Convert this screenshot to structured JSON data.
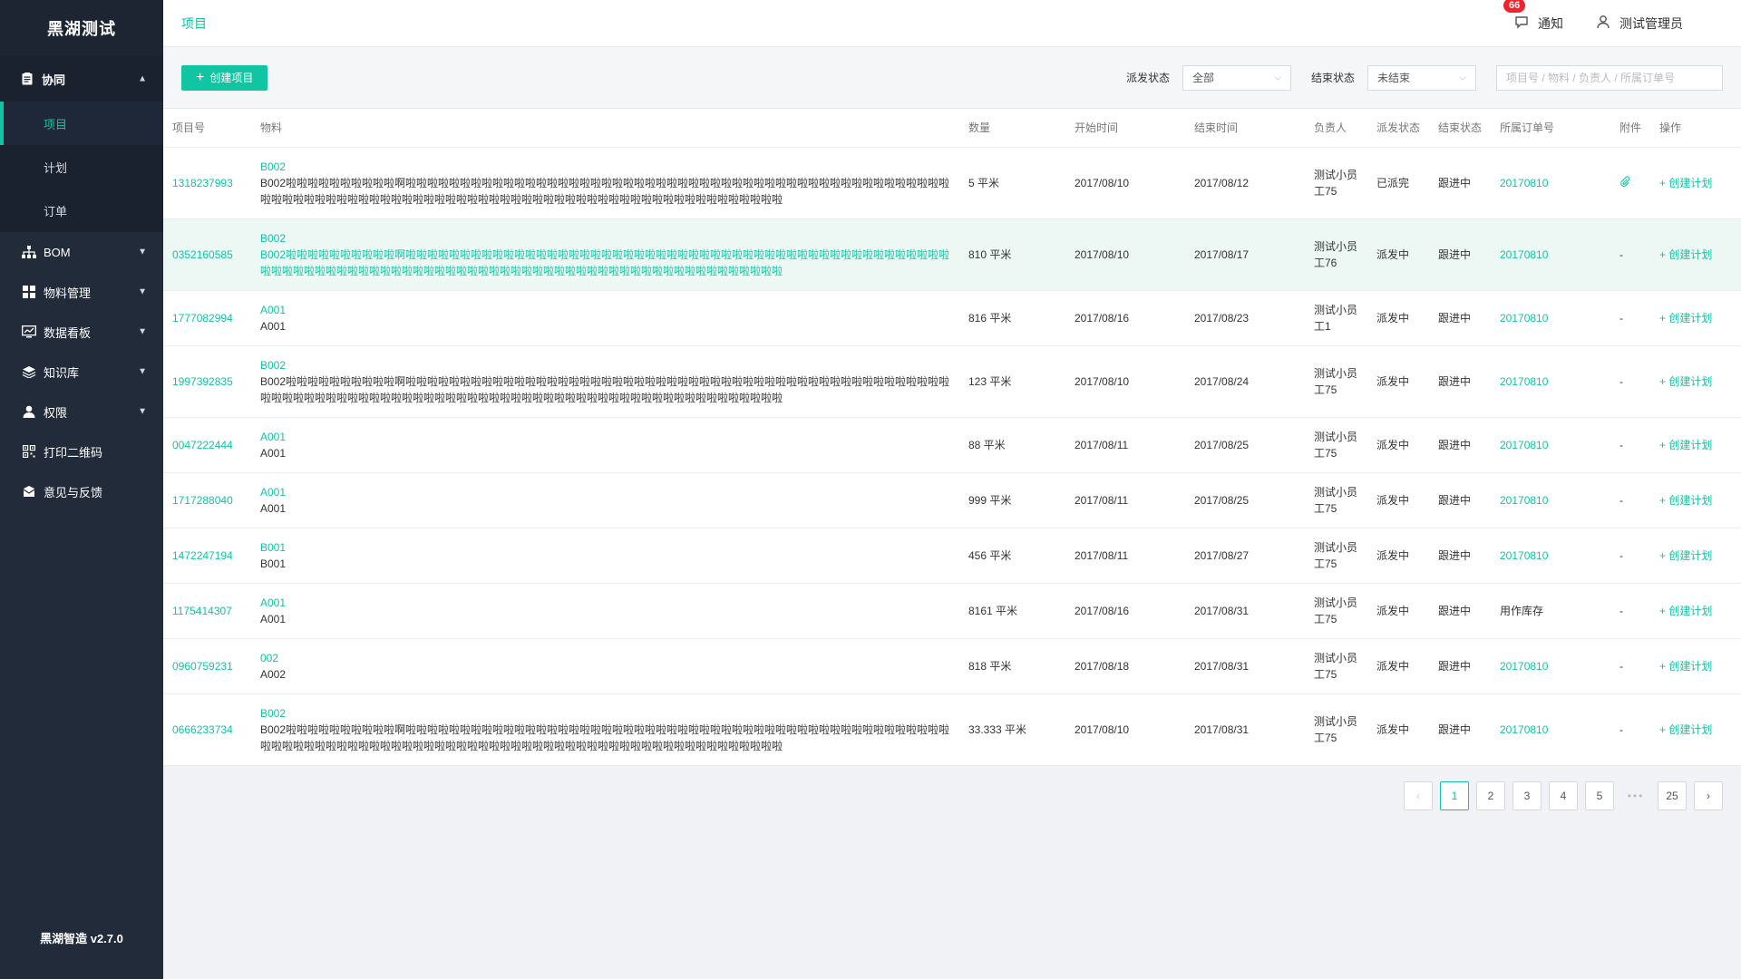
{
  "brand": "黑湖测试",
  "version": "黑湖智造 v2.7.0",
  "sidebar": {
    "group": {
      "label": "协同",
      "icon": "clipboard-icon",
      "items": [
        "项目",
        "计划",
        "订单"
      ],
      "active": 0
    },
    "items": [
      {
        "label": "BOM",
        "icon": "sitemap-icon",
        "chevron": true
      },
      {
        "label": "物料管理",
        "icon": "grid-icon",
        "chevron": true
      },
      {
        "label": "数据看板",
        "icon": "chart-icon",
        "chevron": true
      },
      {
        "label": "知识库",
        "icon": "layers-icon",
        "chevron": true
      },
      {
        "label": "权限",
        "icon": "user-icon",
        "chevron": true
      },
      {
        "label": "打印二维码",
        "icon": "qrcode-icon",
        "chevron": false
      },
      {
        "label": "意见与反馈",
        "icon": "mail-icon",
        "chevron": false
      }
    ]
  },
  "header": {
    "title": "项目",
    "notify_label": "通知",
    "notify_count": "66",
    "user_label": "测试管理员"
  },
  "toolbar": {
    "create_label": "创建项目",
    "dispatch_label": "派发状态",
    "dispatch_value": "全部",
    "end_label": "结束状态",
    "end_value": "未结束",
    "search_placeholder": "项目号 / 物料 / 负责人 / 所属订单号"
  },
  "table": {
    "columns": [
      "项目号",
      "物料",
      "数量",
      "开始时间",
      "结束时间",
      "负责人",
      "派发状态",
      "结束状态",
      "所属订单号",
      "附件",
      "操作"
    ],
    "action_label": "创建计划",
    "rows": [
      {
        "id": "1318237993",
        "code": "B002",
        "desc": "B002啦啦啦啦啦啦啦啦啦啦啊啦啦啦啦啦啦啦啦啦啦啦啦啦啦啦啦啦啦啦啦啦啦啦啦啦啦啦啦啦啦啦啦啦啦啦啦啦啦啦啦啦啦啦啦啦啦啦啦啦啦啦啦啦啦啦啦啦啦啦啦啦啦啦啦啦啦啦啦啦啦啦啦啦啦啦啦啦啦啦啦啦啦啦啦啦啦啦啦啦啦啦啦啦啦啦啦啦啦",
        "qty": "5 平米",
        "start": "2017/08/10",
        "end": "2017/08/12",
        "owner": "测试小员工75",
        "dispatch": "已派完",
        "status": "跟进中",
        "order": "20170810",
        "attachment": "paperclip",
        "tall": true
      },
      {
        "id": "0352160585",
        "code": "B002",
        "desc": "B002啦啦啦啦啦啦啦啦啦啦啊啦啦啦啦啦啦啦啦啦啦啦啦啦啦啦啦啦啦啦啦啦啦啦啦啦啦啦啦啦啦啦啦啦啦啦啦啦啦啦啦啦啦啦啦啦啦啦啦啦啦啦啦啦啦啦啦啦啦啦啦啦啦啦啦啦啦啦啦啦啦啦啦啦啦啦啦啦啦啦啦啦啦啦啦啦啦啦啦啦啦啦啦啦啦啦啦啦啦",
        "qty": "810 平米",
        "start": "2017/08/10",
        "end": "2017/08/17",
        "owner": "测试小员工76",
        "dispatch": "派发中",
        "status": "跟进中",
        "order": "20170810",
        "attachment": "-",
        "tall": true,
        "highlight": true
      },
      {
        "id": "1777082994",
        "code": "A001",
        "desc": "A001",
        "qty": "816 平米",
        "start": "2017/08/16",
        "end": "2017/08/23",
        "owner": "测试小员工1",
        "dispatch": "派发中",
        "status": "跟进中",
        "order": "20170810",
        "attachment": "-"
      },
      {
        "id": "1997392835",
        "code": "B002",
        "desc": "B002啦啦啦啦啦啦啦啦啦啦啊啦啦啦啦啦啦啦啦啦啦啦啦啦啦啦啦啦啦啦啦啦啦啦啦啦啦啦啦啦啦啦啦啦啦啦啦啦啦啦啦啦啦啦啦啦啦啦啦啦啦啦啦啦啦啦啦啦啦啦啦啦啦啦啦啦啦啦啦啦啦啦啦啦啦啦啦啦啦啦啦啦啦啦啦啦啦啦啦啦啦啦啦啦啦啦啦啦啦",
        "qty": "123 平米",
        "start": "2017/08/10",
        "end": "2017/08/24",
        "owner": "测试小员工75",
        "dispatch": "派发中",
        "status": "跟进中",
        "order": "20170810",
        "attachment": "-",
        "tall": true
      },
      {
        "id": "0047222444",
        "code": "A001",
        "desc": "A001",
        "qty": "88 平米",
        "start": "2017/08/11",
        "end": "2017/08/25",
        "owner": "测试小员工75",
        "dispatch": "派发中",
        "status": "跟进中",
        "order": "20170810",
        "attachment": "-"
      },
      {
        "id": "1717288040",
        "code": "A001",
        "desc": "A001",
        "qty": "999 平米",
        "start": "2017/08/11",
        "end": "2017/08/25",
        "owner": "测试小员工75",
        "dispatch": "派发中",
        "status": "跟进中",
        "order": "20170810",
        "attachment": "-"
      },
      {
        "id": "1472247194",
        "code": "B001",
        "desc": "B001",
        "qty": "456 平米",
        "start": "2017/08/11",
        "end": "2017/08/27",
        "owner": "测试小员工75",
        "dispatch": "派发中",
        "status": "跟进中",
        "order": "20170810",
        "attachment": "-"
      },
      {
        "id": "1175414307",
        "code": "A001",
        "desc": "A001",
        "qty": "8161 平米",
        "start": "2017/08/16",
        "end": "2017/08/31",
        "owner": "测试小员工75",
        "dispatch": "派发中",
        "status": "跟进中",
        "order": "用作库存",
        "order_plain": true,
        "attachment": "-"
      },
      {
        "id": "0960759231",
        "code": "002",
        "desc": "A002",
        "qty": "818 平米",
        "start": "2017/08/18",
        "end": "2017/08/31",
        "owner": "测试小员工75",
        "dispatch": "派发中",
        "status": "跟进中",
        "order": "20170810",
        "attachment": "-"
      },
      {
        "id": "0666233734",
        "code": "B002",
        "desc": "B002啦啦啦啦啦啦啦啦啦啦啊啦啦啦啦啦啦啦啦啦啦啦啦啦啦啦啦啦啦啦啦啦啦啦啦啦啦啦啦啦啦啦啦啦啦啦啦啦啦啦啦啦啦啦啦啦啦啦啦啦啦啦啦啦啦啦啦啦啦啦啦啦啦啦啦啦啦啦啦啦啦啦啦啦啦啦啦啦啦啦啦啦啦啦啦啦啦啦啦啦啦啦啦啦啦啦啦啦啦",
        "qty": "33.333 平米",
        "start": "2017/08/10",
        "end": "2017/08/31",
        "owner": "测试小员工75",
        "dispatch": "派发中",
        "status": "跟进中",
        "order": "20170810",
        "attachment": "-",
        "tall": true
      }
    ]
  },
  "pagination": {
    "pages": [
      "1",
      "2",
      "3",
      "4",
      "5",
      "•••",
      "25"
    ],
    "current": "1"
  },
  "colors": {
    "accent": "#11c4a2",
    "sidebar": "#222b3a",
    "badge": "#f5222d"
  }
}
